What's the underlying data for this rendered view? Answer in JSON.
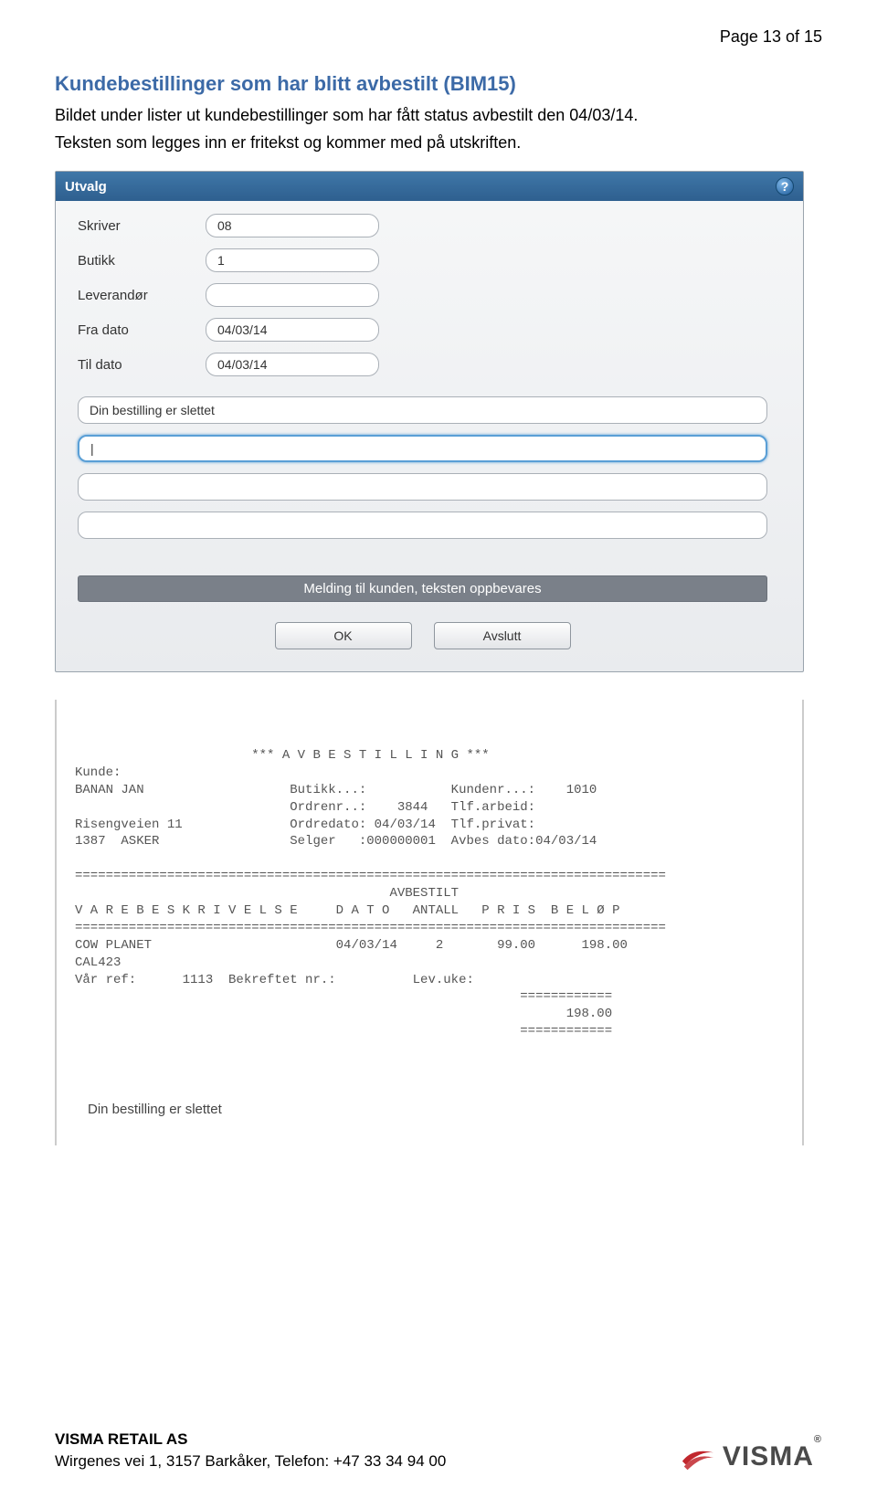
{
  "page_number": "Page 13 of 15",
  "heading": "Kundebestillinger som har blitt avbestilt (BIM15)",
  "body_line1": "Bildet under lister ut kundebestillinger som har fått status avbestilt den 04/03/14.",
  "body_line2": "Teksten som legges inn er fritekst og kommer med på utskriften.",
  "panel": {
    "title": "Utvalg",
    "help": "?",
    "fields": {
      "skriver": {
        "label": "Skriver",
        "value": "08"
      },
      "butikk": {
        "label": "Butikk",
        "value": "1"
      },
      "leverandor": {
        "label": "Leverandør",
        "value": ""
      },
      "fradato": {
        "label": "Fra dato",
        "value": "04/03/14"
      },
      "tildato": {
        "label": "Til dato",
        "value": "04/03/14"
      }
    },
    "lines": {
      "l1": "Din bestilling er slettet",
      "l2": "|",
      "l3": "",
      "l4": ""
    },
    "message": "Melding til kunden, teksten oppbevares",
    "buttons": {
      "ok": "OK",
      "avslutt": "Avslutt"
    }
  },
  "printout": {
    "text": "                       *** A V B E S T I L L I N G ***\nKunde:\nBANAN JAN                   Butikk...:           Kundenr...:    1010\n                            Ordrenr..:    3844   Tlf.arbeid:\nRisengveien 11              Ordredato: 04/03/14  Tlf.privat:\n1387  ASKER                 Selger   :000000001  Avbes dato:04/03/14\n\n=============================================================================\n                                         AVBESTILT\nV A R E B E S K R I V E L S E     D A T O   ANTALL   P R I S  B E L Ø P\n=============================================================================\nCOW PLANET                        04/03/14     2       99.00      198.00\nCAL423\nVår ref:      1113  Bekreftet nr.:          Lev.uke:\n                                                          ============\n                                                                198.00\n                                                          ============",
    "note": "Din bestilling er slettet"
  },
  "footer": {
    "company": "VISMA RETAIL AS",
    "address": "Wirgenes vei 1, 3157 Barkåker, Telefon: +47 33 34 94 00",
    "logo_text": "VISMA",
    "logo_r": "®"
  }
}
